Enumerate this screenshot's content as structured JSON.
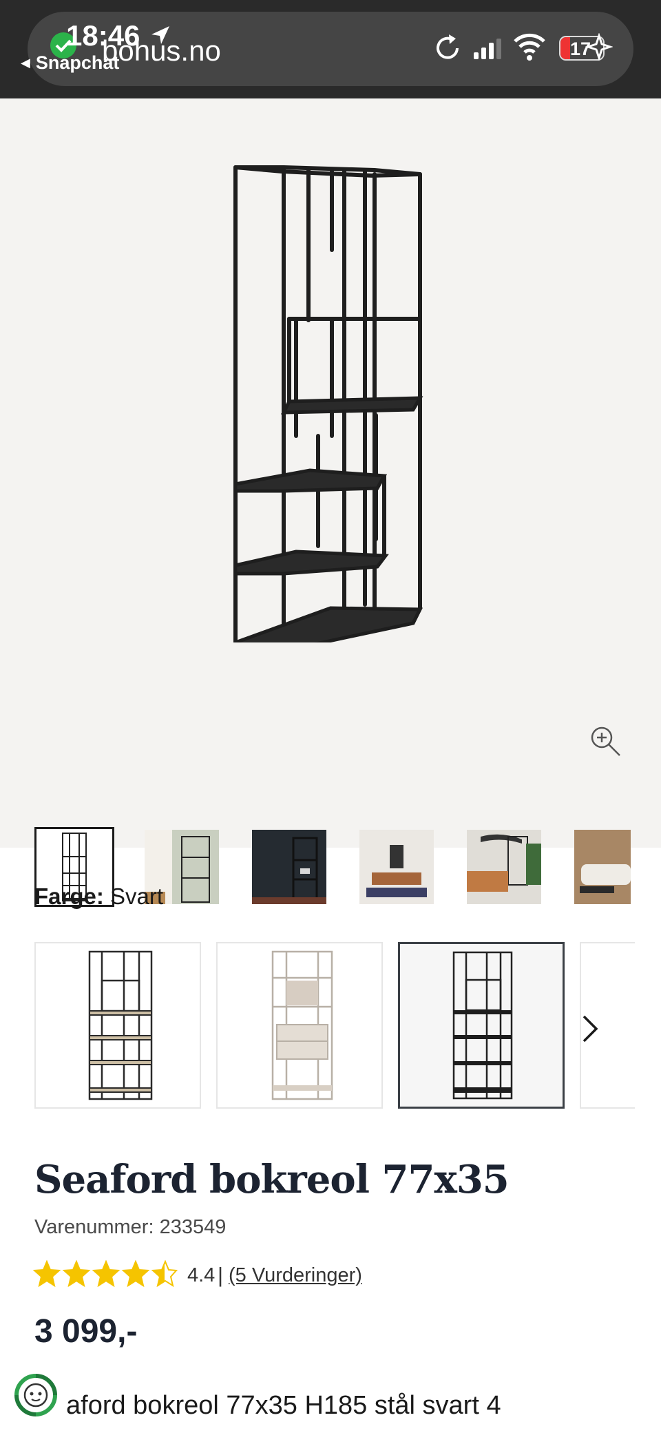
{
  "status_bar": {
    "time": "18:46",
    "back_app": "Snapchat",
    "url": "bohus.no",
    "battery": "17"
  },
  "gallery": {
    "thumbnail_count": 6,
    "active_index": 0
  },
  "color": {
    "label": "Farge:",
    "value": "Svart",
    "options": [
      "Eik/Svart",
      "Beige",
      "Svart"
    ],
    "selected_index": 2
  },
  "product": {
    "title": "Seaford bokreol 77x35",
    "sku": "Varenummer: 233549",
    "rating_value": "4.4",
    "rating_value_fraction": 0.88,
    "rating_separator": "|",
    "rating_link": "(5 Vurderinger)",
    "price": "3 099,-",
    "description_partial": "aford bokreol 77x35 H185 stål svart 4"
  },
  "icons": {
    "zoom": "zoom-in-icon",
    "next": "chevron-right-icon",
    "chat": "chat-assistant-icon"
  },
  "colors": {
    "star": "#f5c400",
    "title": "#1c2331",
    "hero_bg": "#f4f3f1"
  }
}
